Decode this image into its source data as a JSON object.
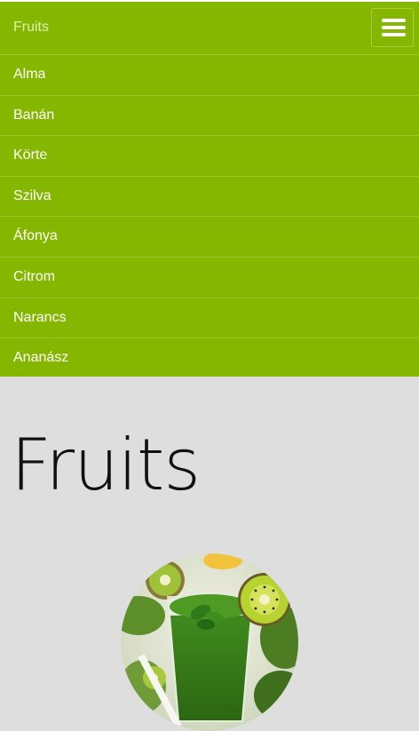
{
  "navbar": {
    "brand": "Fruits",
    "toggle_icon": "hamburger-menu-icon",
    "accent_color": "#86b700",
    "items": [
      {
        "label": "Alma"
      },
      {
        "label": "Banán"
      },
      {
        "label": "Körte"
      },
      {
        "label": "Szilva"
      },
      {
        "label": "Áfonya"
      },
      {
        "label": "Citrom"
      },
      {
        "label": "Narancs"
      },
      {
        "label": "Ananász"
      }
    ]
  },
  "main": {
    "title": "Fruits",
    "image": "green-smoothie-photo"
  }
}
